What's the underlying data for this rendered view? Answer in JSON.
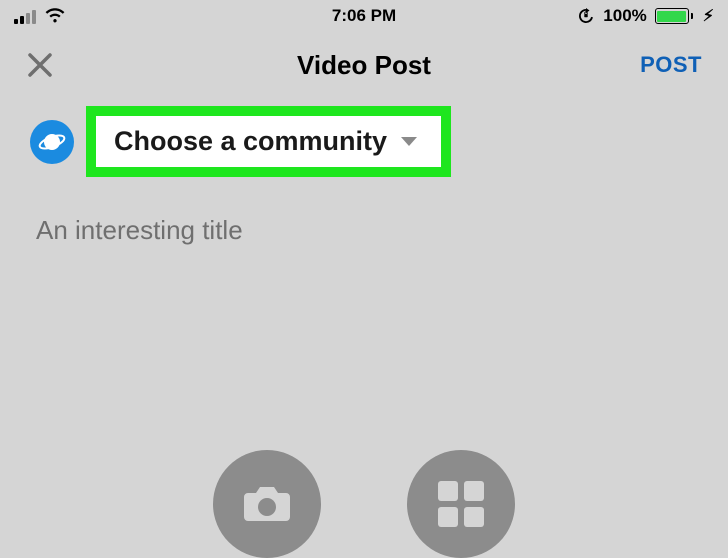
{
  "status_bar": {
    "time": "7:06 PM",
    "battery_pct": "100%"
  },
  "nav": {
    "title": "Video Post",
    "post_label": "POST"
  },
  "community": {
    "selector_label": "Choose a community"
  },
  "title_input": {
    "placeholder": "An interesting title",
    "value": ""
  }
}
